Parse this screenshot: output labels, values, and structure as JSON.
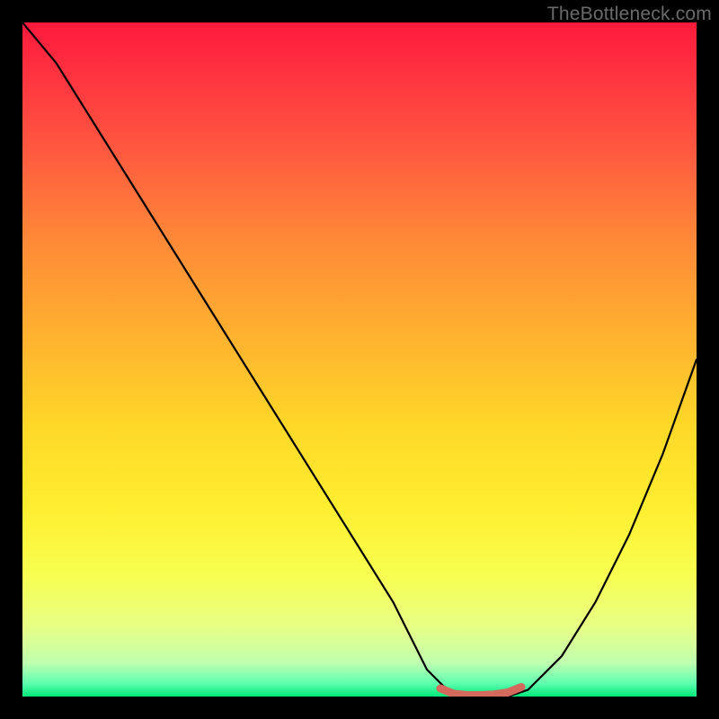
{
  "watermark": "TheBottleneck.com",
  "colors": {
    "frame": "#000000",
    "curve_stroke": "#000000",
    "minimum_marker": "#d46a5e"
  },
  "chart_data": {
    "type": "line",
    "title": "",
    "xlabel": "",
    "ylabel": "",
    "xlim": [
      0,
      100
    ],
    "ylim": [
      0,
      100
    ],
    "grid": false,
    "legend": false,
    "series": [
      {
        "name": "bottleneck-curve",
        "x": [
          0,
          5,
          10,
          15,
          20,
          25,
          30,
          35,
          40,
          45,
          50,
          55,
          58,
          60,
          63,
          66,
          69,
          72,
          75,
          80,
          85,
          90,
          95,
          100
        ],
        "y": [
          100,
          94,
          86,
          78,
          70,
          62,
          54,
          46,
          38,
          30,
          22,
          14,
          8,
          4,
          1,
          0,
          0,
          0,
          1,
          6,
          14,
          24,
          36,
          50
        ]
      },
      {
        "name": "minimum-marker",
        "x": [
          62,
          64,
          66,
          68,
          70,
          72,
          74
        ],
        "y": [
          1.2,
          0.4,
          0.2,
          0.2,
          0.3,
          0.6,
          1.4
        ]
      }
    ]
  }
}
